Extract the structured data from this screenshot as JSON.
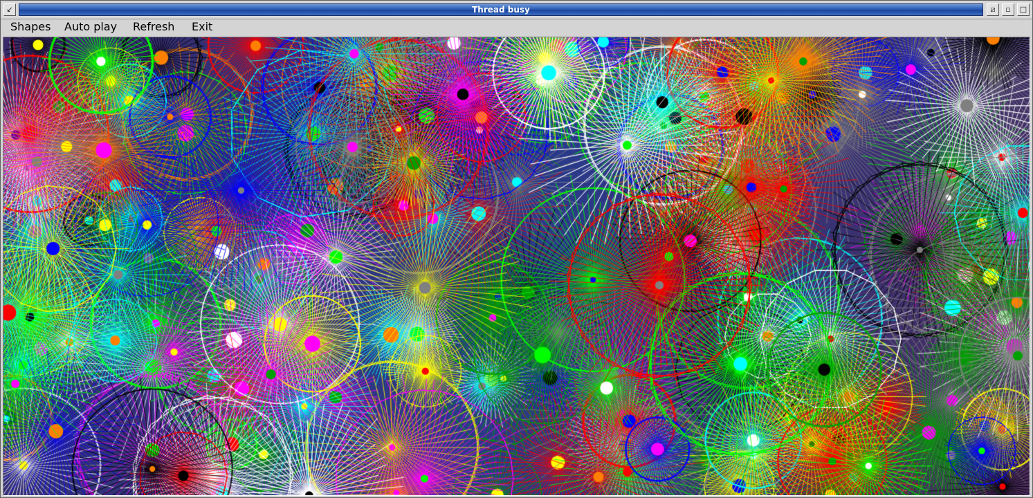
{
  "window": {
    "title": "Thread busy"
  },
  "titlebar": {
    "close_icon": "close-icon",
    "zoom_icon": "zoom-icon",
    "depth_icons": [
      "depth-back-icon",
      "depth-front-icon"
    ]
  },
  "menu": {
    "items": [
      {
        "label": "Shapes"
      },
      {
        "label": "Auto play"
      },
      {
        "label": "Refresh"
      },
      {
        "label": "Exit"
      }
    ]
  },
  "canvas": {
    "palette": [
      "#ff0000",
      "#00ff00",
      "#0000ff",
      "#ffff00",
      "#ff00ff",
      "#00ffff",
      "#ffffff",
      "#000000",
      "#808080",
      "#00a000",
      "#ff8000"
    ],
    "shape": "radial-starburst"
  }
}
